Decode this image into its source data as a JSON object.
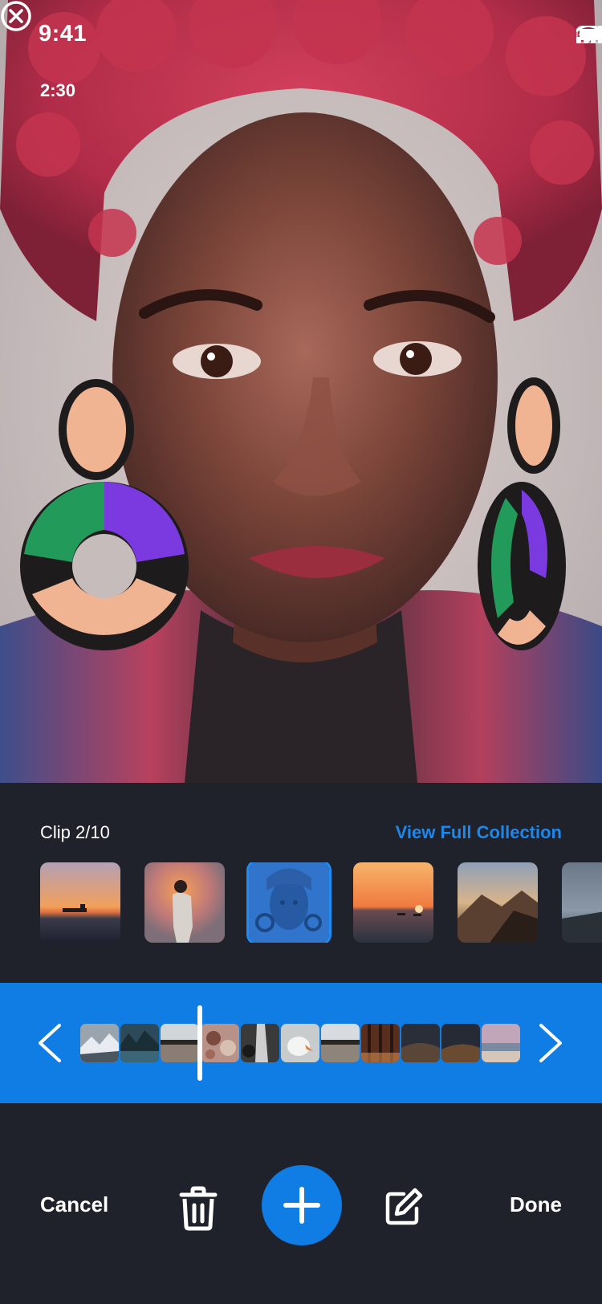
{
  "status_bar": {
    "time": "9:41",
    "icons": [
      "cellular-signal-icon",
      "wifi-icon",
      "battery-icon"
    ]
  },
  "viewer": {
    "duration": "2:30",
    "close_icon": "close-circle-icon",
    "photo_subject": "portrait-woman-red-hair"
  },
  "collection": {
    "clip_label": "Clip 2/10",
    "view_full_label": "View Full Collection",
    "selected_index": 2,
    "thumbnails": [
      {
        "name": "thumb-ship-sunset"
      },
      {
        "name": "thumb-man-orange-light"
      },
      {
        "name": "thumb-woman-portrait"
      },
      {
        "name": "thumb-sea-sunset-kayak"
      },
      {
        "name": "thumb-mountain-coast"
      },
      {
        "name": "thumb-coast-partial"
      }
    ]
  },
  "timeline": {
    "prev_icon": "chevron-left-icon",
    "next_icon": "chevron-right-icon",
    "frames": [
      "frame-snowy-mountain",
      "frame-forest-lake",
      "frame-lake-reflection",
      "frame-food-table",
      "frame-bw-waterfall",
      "frame-white-bird",
      "frame-lake-reflection-2",
      "frame-forest-trees",
      "frame-dark-hills",
      "frame-dark-hills-2",
      "frame-beach-dusk"
    ]
  },
  "toolbar": {
    "cancel_label": "Cancel",
    "done_label": "Done",
    "trash_icon": "trash-icon",
    "add_icon": "plus-icon",
    "edit_icon": "edit-icon"
  },
  "colors": {
    "accent": "#0f7de4",
    "link": "#1d87ec",
    "background": "#1f222b"
  }
}
